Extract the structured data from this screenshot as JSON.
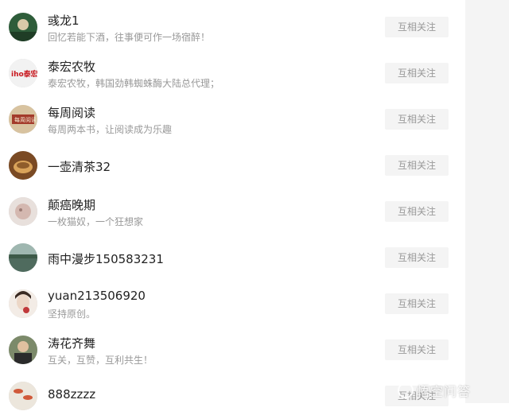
{
  "follow_label": "互相关注",
  "users": [
    {
      "name": "彧龙1",
      "desc": "回忆若能下酒，往事便可作一场宿醉！",
      "avatar": "avatar-landscape-green"
    },
    {
      "name": "泰宏农牧",
      "desc": "泰宏农牧，韩国劲韩蜘蛛酶大陆总代理；",
      "avatar": "avatar-logo-red"
    },
    {
      "name": "每周阅读",
      "desc": "每周两本书，让阅读成为乐趣",
      "avatar": "avatar-reading-badge"
    },
    {
      "name": "一壶清茶32",
      "desc": "",
      "avatar": "avatar-tea-cup"
    },
    {
      "name": "颠癌晚期",
      "desc": "一枚猫奴，一个狂想家",
      "avatar": "avatar-blurry-face"
    },
    {
      "name": "雨中漫步150583231",
      "desc": "",
      "avatar": "avatar-lake-scene"
    },
    {
      "name": "yuan213506920",
      "desc": "坚持原创。",
      "avatar": "avatar-drawn-portrait"
    },
    {
      "name": "涛花齐舞",
      "desc": "互关，互赞，互利共生！",
      "avatar": "avatar-man-photo"
    },
    {
      "name": "888zzzz",
      "desc": "",
      "avatar": "avatar-fish-pattern"
    }
  ],
  "watermark": {
    "text": "悟空问答"
  }
}
